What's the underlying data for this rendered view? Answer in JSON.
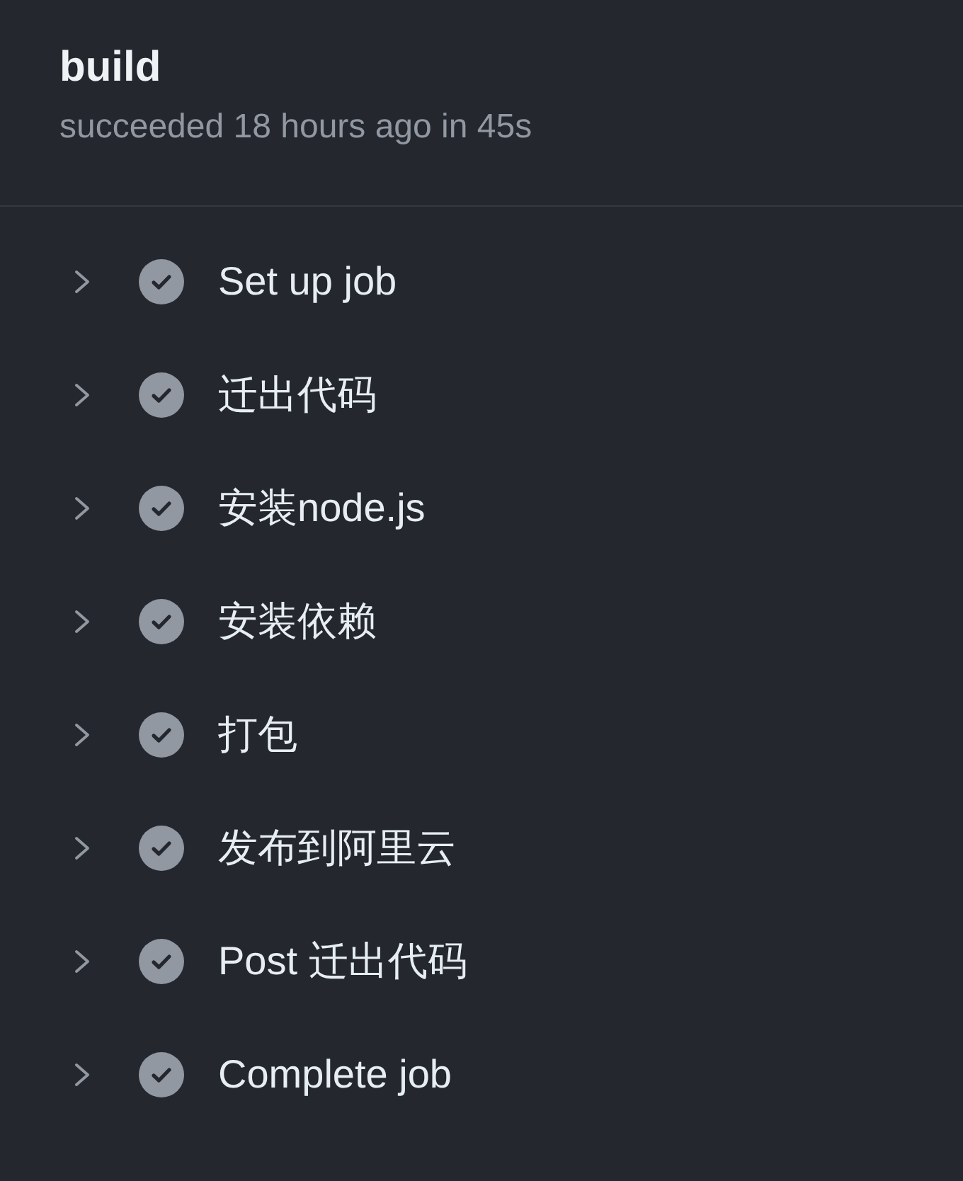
{
  "job": {
    "title": "build",
    "summary": "succeeded 18 hours ago in 45s"
  },
  "steps": [
    {
      "name": "Set up job",
      "completed": true,
      "expanded": false
    },
    {
      "name": "迁出代码",
      "completed": true,
      "expanded": false
    },
    {
      "name": "安装node.js",
      "completed": true,
      "expanded": false
    },
    {
      "name": "安装依赖",
      "completed": true,
      "expanded": false
    },
    {
      "name": "打包",
      "completed": true,
      "expanded": false
    },
    {
      "name": "发布到阿里云",
      "completed": true,
      "expanded": false
    },
    {
      "name": "Post 迁出代码",
      "completed": true,
      "expanded": false
    },
    {
      "name": "Complete job",
      "completed": true,
      "expanded": false
    }
  ]
}
